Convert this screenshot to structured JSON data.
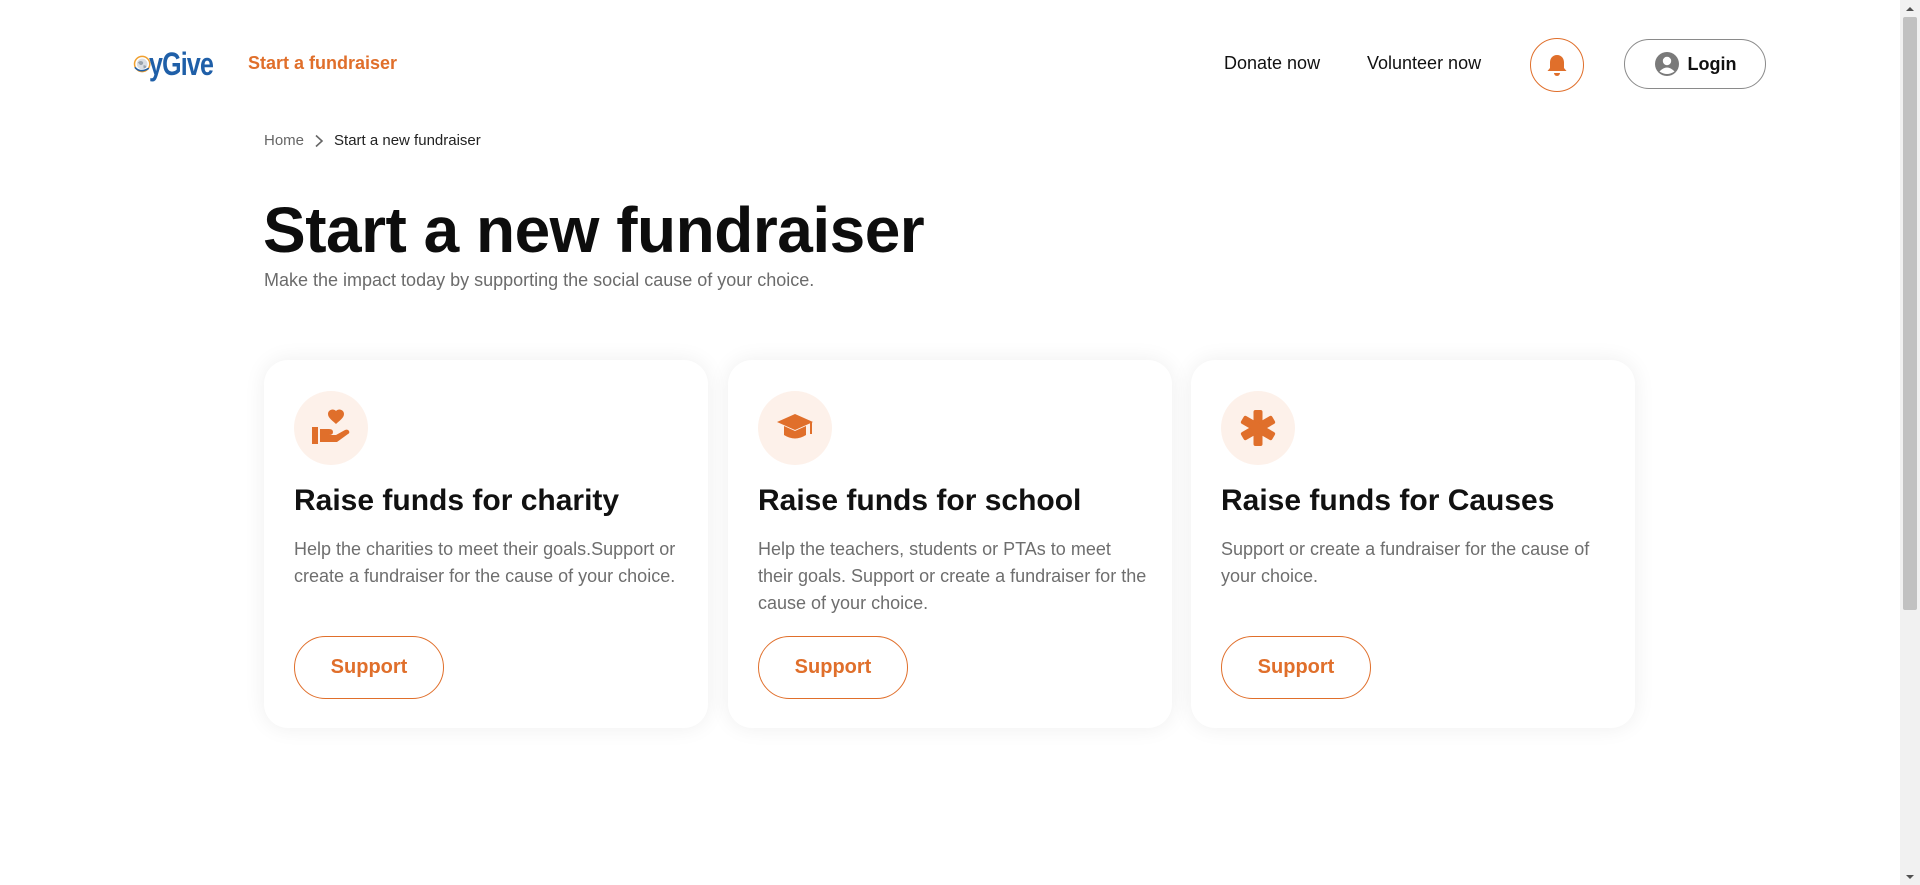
{
  "colors": {
    "accent": "#e06f2b",
    "logo_blue": "#1f5fa8",
    "logo_orange": "#f0a030",
    "icon_bg": "#fdf1ea",
    "muted_text": "#6e6e6e"
  },
  "header": {
    "logo_text": "yGive",
    "start_fundraiser_label": "Start a fundraiser",
    "nav": {
      "donate_label": "Donate now",
      "volunteer_label": "Volunteer now"
    },
    "notification_icon": "bell-icon",
    "login_label": "Login",
    "login_icon": "user-circle-icon"
  },
  "breadcrumb": {
    "home": "Home",
    "separator_icon": "chevron-right-icon",
    "current": "Start a new fundraiser"
  },
  "page": {
    "title": "Start a new fundraiser",
    "subtitle": "Make the impact today by supporting the social cause of your choice."
  },
  "cards": [
    {
      "icon": "hand-heart-icon",
      "title": "Raise funds for charity",
      "description": "Help the charities to meet their goals.Support or create a fundraiser for the cause of your choice.",
      "button_label": "Support"
    },
    {
      "icon": "graduation-cap-icon",
      "title": "Raise funds for school",
      "description": "Help the teachers, students or PTAs to meet their goals. Support or create a fundraiser for the cause of your choice.",
      "button_label": "Support"
    },
    {
      "icon": "asterisk-icon",
      "title": "Raise funds for Causes",
      "description": "Support or create a fundraiser for the cause of your choice.",
      "button_label": "Support"
    }
  ]
}
